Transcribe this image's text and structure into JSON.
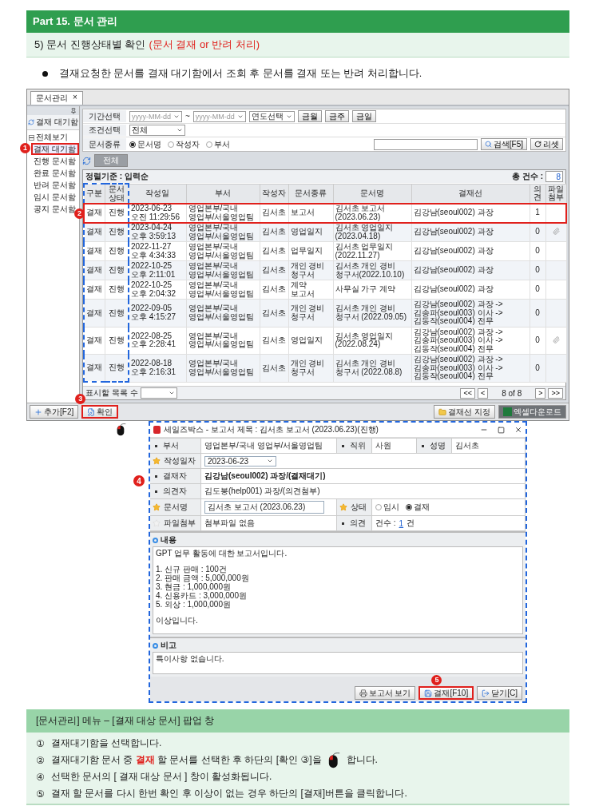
{
  "part_header": {
    "title": "Part 15. 문서 관리"
  },
  "section": {
    "title": "5) 문서 진행상태별 확인",
    "subtitle": "(문서 결재 or 반려 처리)"
  },
  "bullet": "결재요청한 문서를 결재 대기함에서 조회 후 문서를 결재 또는 반려 처리합니다.",
  "app": {
    "tab": {
      "label": "문서관리",
      "close": "×"
    },
    "sidebar": {
      "header_item": "결재 대기함",
      "tree": {
        "label": "전체보기",
        "expanded": true,
        "children": [
          {
            "label": "결재 대기함",
            "selected": true,
            "marker": "1"
          },
          {
            "label": "진행 문서함",
            "selected": false
          },
          {
            "label": "완료 문서함",
            "selected": false
          },
          {
            "label": "반려 문서함",
            "selected": false
          },
          {
            "label": "임시 문서함",
            "selected": false
          },
          {
            "label": "공지 문서함",
            "selected": false
          }
        ]
      }
    },
    "filters": {
      "period": {
        "label": "기간선택",
        "from_placeholder": "yyyy-MM-dd",
        "separator": "~",
        "to_placeholder": "yyyy-MM-dd",
        "year_select": "연도선택",
        "buttons": [
          "금월",
          "금주",
          "금일"
        ]
      },
      "condition": {
        "label": "조건선택",
        "value": "전체"
      },
      "doc_type": {
        "label": "문서종류",
        "options": [
          {
            "label": "문서명",
            "selected": true
          },
          {
            "label": "작성자",
            "selected": false
          },
          {
            "label": "부서",
            "selected": false
          }
        ],
        "search_button": "검색[F5]",
        "reset_button": "리셋"
      }
    },
    "toolbar": {
      "all_button": "전체"
    },
    "sort_label": "정렬기준 : 입력순",
    "count_label": "총 건수 :",
    "count_value": "8",
    "columns": [
      "구분",
      "문서상태",
      "작성일",
      "부서",
      "작성자",
      "문서종류",
      "문서명",
      "결재선",
      "의견",
      "파일첨부"
    ],
    "rows": [
      {
        "selected": true,
        "marker": "2",
        "attachment": false,
        "cells": [
          "결재",
          "진행",
          "2023-06-23 오전 11:29:56",
          "영업본부/국내 영업부/서울영업팀",
          "김서초",
          "보고서",
          "김서초 보고서 (2023.06.23)",
          "김강남(seoul002) 과장",
          "1"
        ]
      },
      {
        "selected": false,
        "attachment": true,
        "cells": [
          "결재",
          "진행",
          "2023-04-24 오후 3:59:13",
          "영업본부/국내 영업부/서울영업팀",
          "김서초",
          "영업일지",
          "김서초 영업일지 (2023.04.18)",
          "김강남(seoul002) 과장",
          "0"
        ]
      },
      {
        "selected": false,
        "attachment": false,
        "cells": [
          "결재",
          "진행",
          "2022-11-27 오후 4:34:33",
          "영업본부/국내 영업부/서울영업팀",
          "김서초",
          "업무일지",
          "김서초 업무일지 (2022.11.27)",
          "김강남(seoul002) 과장",
          "0"
        ]
      },
      {
        "selected": false,
        "attachment": false,
        "cells": [
          "결재",
          "진행",
          "2022-10-25 오후 2:11:01",
          "영업본부/국내 영업부/서울영업팀",
          "김서초",
          "개인 경비 청구서",
          "김서초 개인 경비 청구서(2022.10.10)",
          "김강남(seoul002) 과장",
          "0"
        ]
      },
      {
        "selected": false,
        "attachment": false,
        "cells": [
          "결재",
          "진행",
          "2022-10-25 오후 2:04:32",
          "영업본부/국내 영업부/서울영업팀",
          "김서초",
          "계약 보고서",
          "사무실 가구 계약",
          "김강남(seoul002) 과장",
          "0"
        ]
      },
      {
        "selected": false,
        "attachment": false,
        "cells": [
          "결재",
          "진행",
          "2022-09-05 오후 4:15:27",
          "영업본부/국내 영업부/서울영업팀",
          "김서초",
          "개인 경비 청구서",
          "김서초 개인 경비 청구서 (2022.09.05)",
          "김강남(seoul002) 과장 -> 김송파(seoul003) 이사 -> 김동작(seoul004) 전무",
          "0"
        ]
      },
      {
        "selected": false,
        "attachment": true,
        "cells": [
          "결재",
          "진행",
          "2022-08-25 오후 2:28:41",
          "영업본부/국내 영업부/서울영업팀",
          "김서초",
          "영업일지",
          "김서초 영업일지 (2022.08.24)",
          "김강남(seoul002) 과장 -> 김송파(seoul003) 이사 -> 김동작(seoul004) 전무",
          "0"
        ]
      },
      {
        "selected": false,
        "attachment": false,
        "cells": [
          "결재",
          "진행",
          "2022-08-18 오후 2:16:31",
          "영업본부/국내 영업부/서울영업팀",
          "김서초",
          "개인 경비 청구서",
          "김서초 개인 경비 청구서 (2022.08.8)",
          "김강남(seoul002) 과장 -> 김송파(seoul003) 이사 -> 김동작(seoul004) 전무",
          "0"
        ]
      }
    ],
    "pager": {
      "page_size_label": "표시할 목록 수",
      "first": "<<",
      "prev": "<",
      "info": "8 of 8",
      "next": ">",
      "last": ">>"
    },
    "bottom_buttons": [
      {
        "kind": "add",
        "label": "추가[F2]",
        "highlighted": false
      },
      {
        "kind": "confirm",
        "label": "확인",
        "highlighted": true,
        "marker": "3"
      },
      {
        "kind": "approval_line",
        "label": "결재선 지정",
        "highlighted": false
      },
      {
        "kind": "excel",
        "label": "엑셀다운로드",
        "highlighted": false
      }
    ]
  },
  "popup": {
    "marker": "4",
    "title": "세일즈박스 - 보고서 제목 : 김서초 보고서 (2023.06.23)(진행)",
    "rows": [
      [
        {
          "kind": "bullet",
          "label": "부서",
          "value": "영업본부/국내 영업부/서울영업팀"
        },
        {
          "kind": "bullet",
          "label": "직위",
          "value": "사원"
        },
        {
          "kind": "bullet",
          "label": "성명",
          "value": "김서초"
        }
      ],
      [
        {
          "kind": "star",
          "label": "작성일자",
          "dropdown": true,
          "value": "2023-06-23"
        }
      ],
      [
        {
          "kind": "bullet",
          "label": "결재자",
          "emphasized": true,
          "value": "김강남(seoul002) 과장/(결재대기)"
        }
      ],
      [
        {
          "kind": "bullet",
          "label": "의견자",
          "emphasized": false,
          "value": "김도봉(help001) 과장/(의견첨부)"
        }
      ],
      [
        {
          "kind": "star",
          "label": "문서명",
          "editable": true,
          "value": "김서초 보고서 (2023.06.23)"
        },
        {
          "kind": "star",
          "label": "상태",
          "options": [
            {
              "label": "임시",
              "selected": false
            },
            {
              "label": "결재",
              "selected": true
            }
          ]
        }
      ],
      [
        {
          "kind": "star_faded",
          "label": "파일첨부",
          "value": "첨부파일 없음"
        },
        {
          "kind": "bullet",
          "label": "의견",
          "prefix": "건수 :",
          "link": "1",
          "suffix": "건"
        }
      ]
    ],
    "content": {
      "title": "내용",
      "paragraphs": [
        {
          "lines": [
            "GPT 업무 활동에 대한 보고서입니다."
          ]
        },
        {
          "lines": [
            "1. 신규 판매 : 100건",
            "2. 판매 금액 : 5,000,000원",
            "3. 현금 : 1,000,000원",
            "4. 신용카드 : 3,000,000원",
            "5. 외상 : 1,000,000원"
          ]
        },
        {
          "lines": [
            "이상입니다."
          ]
        }
      ]
    },
    "remarks": {
      "title": "비고",
      "text": "특이사항 없습니다."
    },
    "buttons": [
      {
        "kind": "report",
        "label": "보고서 보기",
        "highlighted": false
      },
      {
        "kind": "approve",
        "label": "결재[F10]",
        "highlighted": true,
        "marker": "5"
      },
      {
        "kind": "close",
        "label": "닫기[C]",
        "highlighted": false
      }
    ]
  },
  "notes": {
    "title": "[문서관리] 메뉴 – [결재 대상 문서] 팝업 창",
    "items": [
      {
        "mark": "①",
        "text": "결재대기함을 선택합니다.",
        "mouse": false
      },
      {
        "mark": "②",
        "text": "결재대기함 문서 중 **결재** 할 문서를 선택한 후 하단의 [확인 ③]을",
        "mouse": true,
        "after": "합니다."
      },
      {
        "mark": "④",
        "text": "선택한 문서의 [ 결재 대상 문서 ] 창이 활성화됩니다.",
        "mouse": false
      },
      {
        "mark": "⑤",
        "text": "결재 할 문서를 다시 한번 확인 후 이상이 없는 경우 하단의 [결재]버튼을 클릭합니다.",
        "mouse": false
      }
    ]
  }
}
